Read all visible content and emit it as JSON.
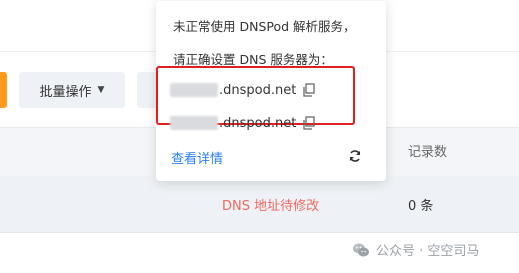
{
  "toolbar": {
    "bulk_label": "批量操作"
  },
  "table": {
    "col_records": "记录数",
    "row": {
      "status": "DNS 地址待修改",
      "records": "0 条"
    }
  },
  "popover": {
    "line1": "未正常使用 DNSPod 解析服务，",
    "line2": "请正确设置 DNS 服务器为：",
    "servers": [
      ".dnspod.net",
      ".dnspod.net"
    ],
    "link": "查看详情"
  },
  "watermark": {
    "text": "公众号 · 空空司马"
  },
  "colors": {
    "accent": "#ff9a1f",
    "warn": "#ee6a61",
    "link": "#2a7ff5",
    "highlight": "#e02020"
  },
  "icons": [
    "chevron-down-icon",
    "copy-icon",
    "refresh-icon",
    "wechat-icon"
  ]
}
